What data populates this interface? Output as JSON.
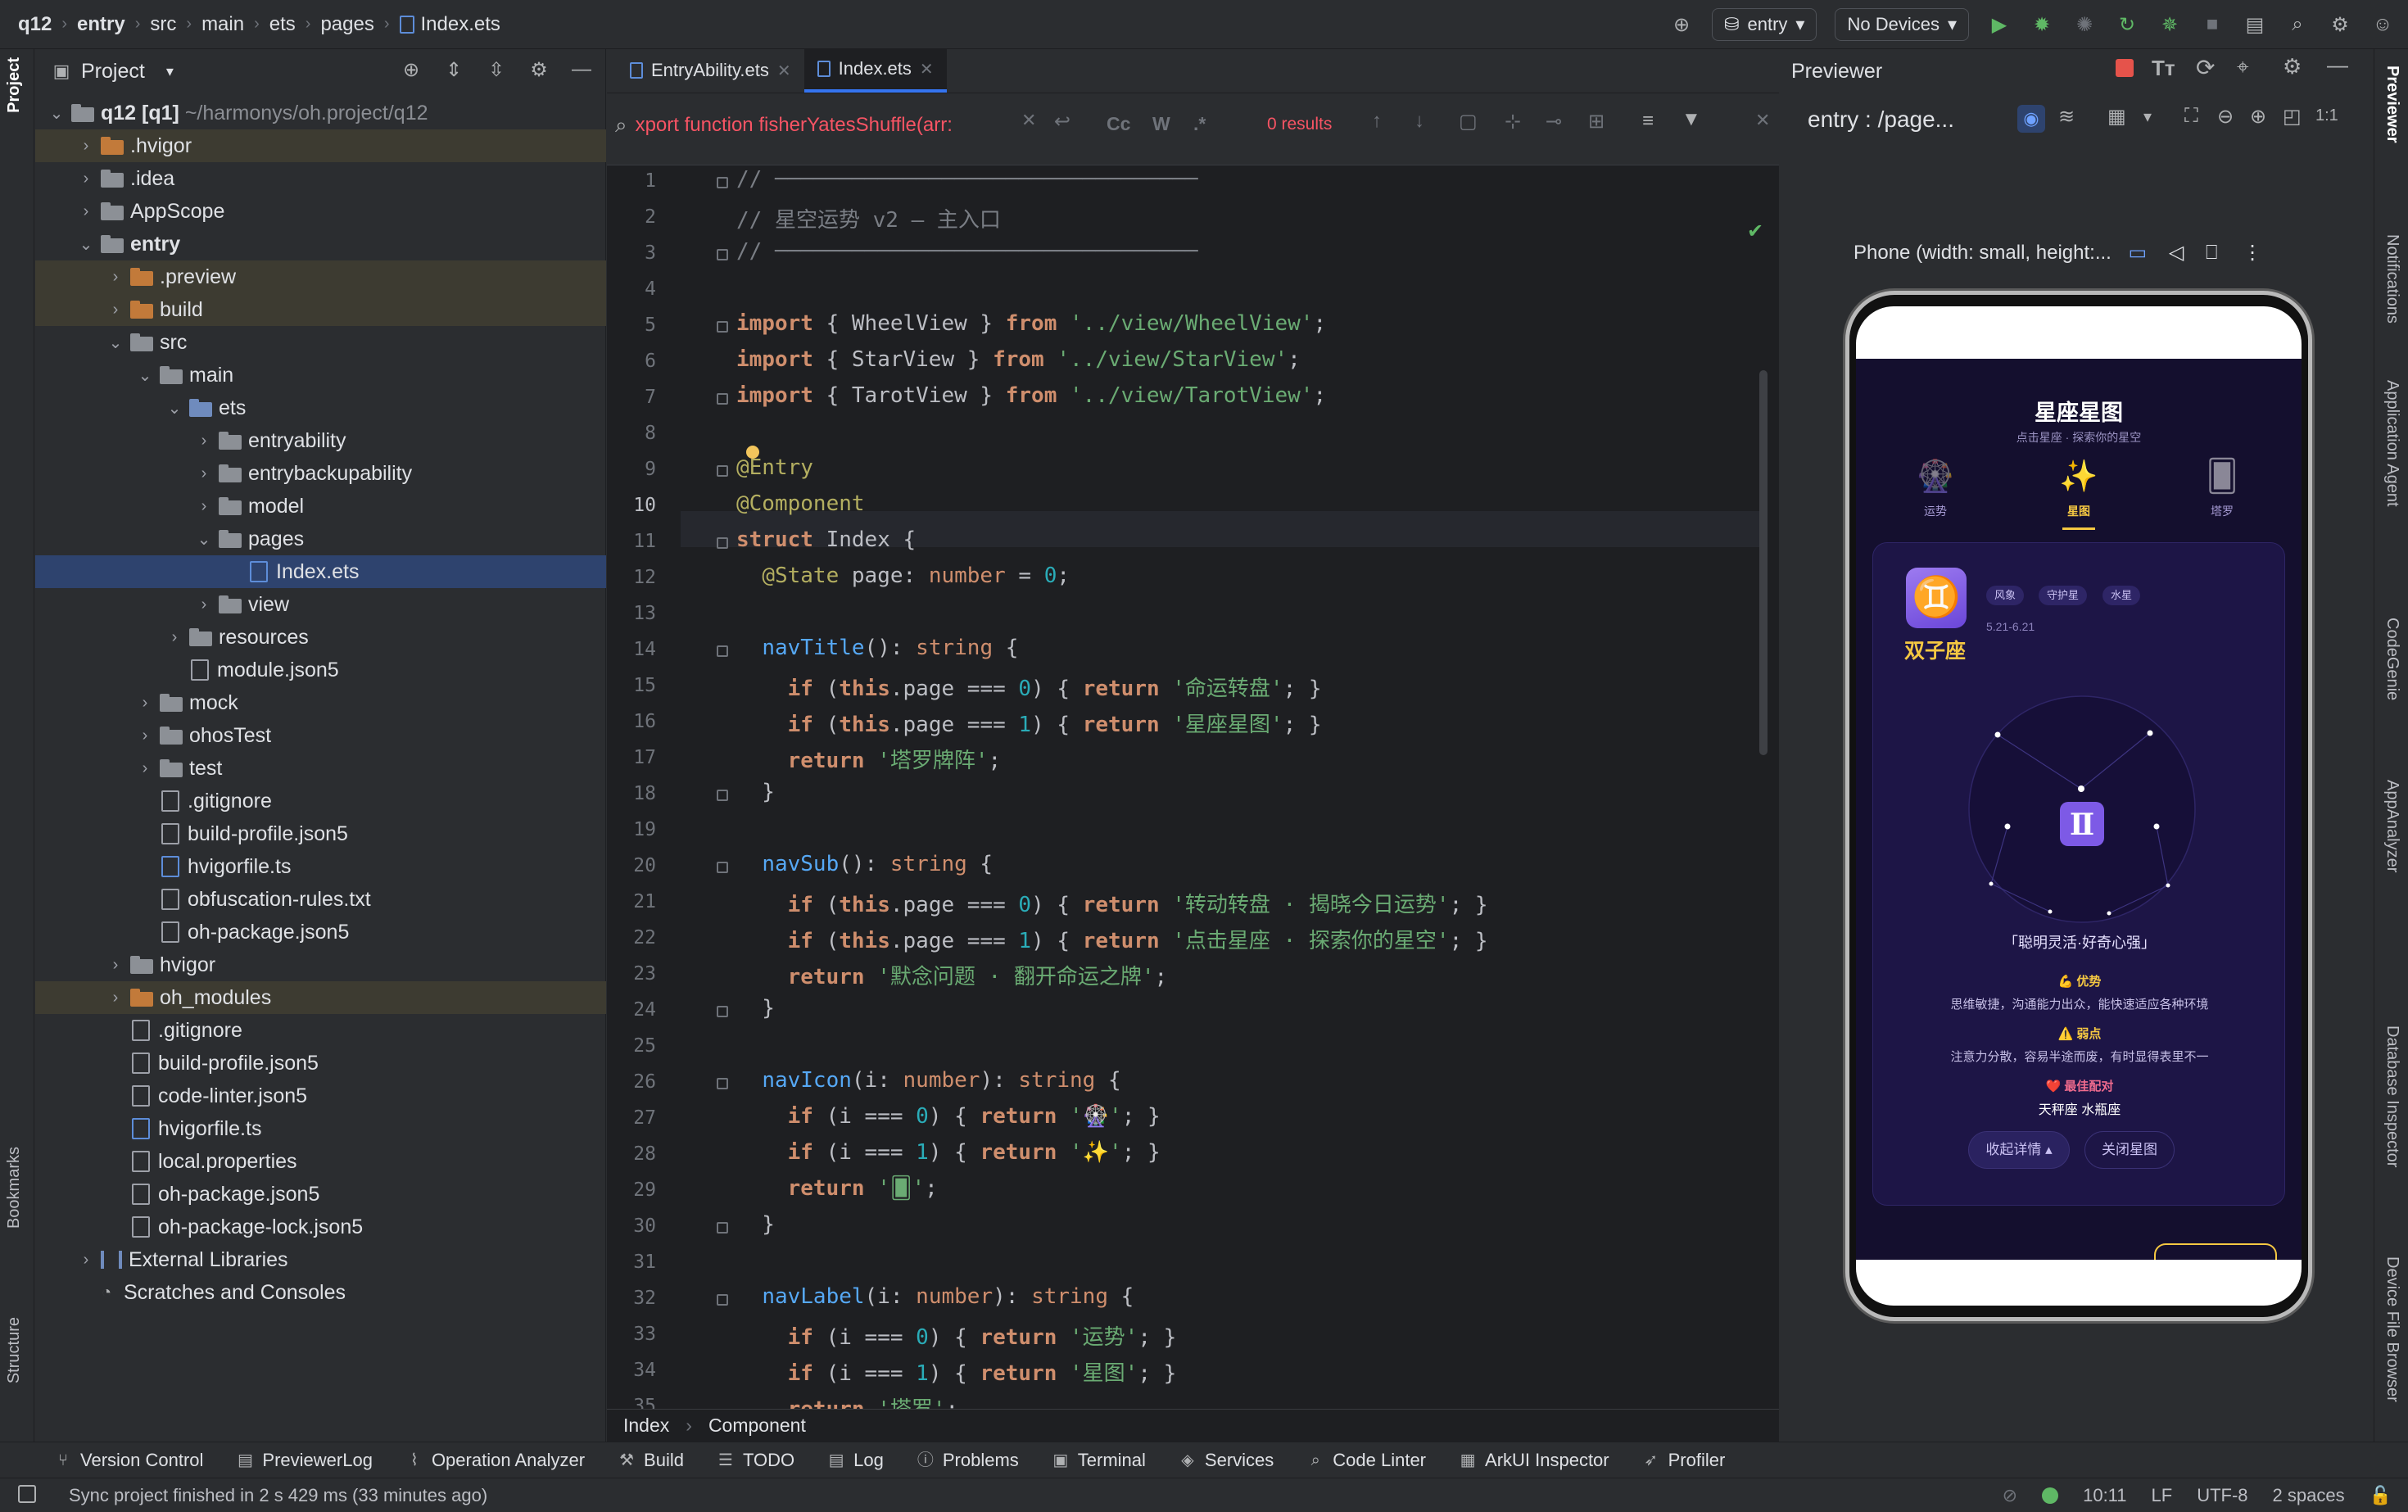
{
  "titlebar": {
    "crumbs": [
      "q12",
      "entry",
      "src",
      "main",
      "ets",
      "pages",
      "Index.ets"
    ],
    "run_config": "entry",
    "device": "No Devices"
  },
  "left_strip": {
    "project": "Project",
    "bookmarks": "Bookmarks",
    "structure": "Structure"
  },
  "right_strip": {
    "previewer": "Previewer",
    "notifications": "Notifications",
    "app_agent": "Application Agent",
    "codegenie": "CodeGenie",
    "appanalyzer": "AppAnalyzer",
    "db_inspector": "Database Inspector",
    "device_file": "Device File Browser"
  },
  "project": {
    "title": "Project",
    "root": "q12 [q1]",
    "root_path": "~/harmonys/oh.project/q12",
    "items": [
      ".hvigor",
      ".idea",
      "AppScope",
      "entry",
      ".preview",
      "build",
      "src",
      "main",
      "ets",
      "entryability",
      "entrybackupability",
      "model",
      "pages",
      "Index.ets",
      "view",
      "resources",
      "module.json5",
      "mock",
      "ohosTest",
      "test",
      ".gitignore",
      "build-profile.json5",
      "hvigorfile.ts",
      "obfuscation-rules.txt",
      "oh-package.json5",
      "hvigor",
      "oh_modules",
      ".gitignore",
      "build-profile.json5",
      "code-linter.json5",
      "hvigorfile.ts",
      "local.properties",
      "oh-package.json5",
      "oh-package-lock.json5",
      "External Libraries",
      "Scratches and Consoles"
    ]
  },
  "editor": {
    "tabs": [
      "EntryAbility.ets",
      "Index.ets"
    ],
    "find_query": "xport function fisherYatesShuffle(arr:",
    "find_results": "0 results",
    "find_opts": [
      "Cc",
      "W",
      ".*"
    ],
    "breadcrumb": [
      "Index",
      "Component"
    ],
    "line_numbers": [
      "1",
      "2",
      "3",
      "4",
      "5",
      "6",
      "7",
      "8",
      "9",
      "10",
      "11",
      "12",
      "13",
      "14",
      "15",
      "16",
      "17",
      "18",
      "19",
      "20",
      "21",
      "22",
      "23",
      "24",
      "25",
      "26",
      "27",
      "28",
      "29",
      "30",
      "31",
      "32",
      "33",
      "34",
      "35"
    ],
    "code_lines": [
      "// ─────────────────────────────────",
      "// 星空运势 v2 — 主入口",
      "// ─────────────────────────────────",
      "",
      "import { WheelView } from '../view/WheelView';",
      "import { StarView } from '../view/StarView';",
      "import { TarotView } from '../view/TarotView';",
      "",
      "@Entry",
      "@Component",
      "struct Index {",
      "  @State page: number = 0;",
      "",
      "  navTitle(): string {",
      "    if (this.page === 0) { return '命运转盘'; }",
      "    if (this.page === 1) { return '星座星图'; }",
      "    return '塔罗牌阵';",
      "  }",
      "",
      "  navSub(): string {",
      "    if (this.page === 0) { return '转动转盘 · 揭晓今日运势'; }",
      "    if (this.page === 1) { return '点击星座 · 探索你的星空'; }",
      "    return '默念问题 · 翻开命运之牌';",
      "  }",
      "",
      "  navIcon(i: number): string {",
      "    if (i === 0) { return '🎡'; }",
      "    if (i === 1) { return '✨'; }",
      "    return '🂠';",
      "  }",
      "",
      "  navLabel(i: number): string {",
      "    if (i === 0) { return '运势'; }",
      "    if (i === 1) { return '星图'; }",
      "    return '塔罗';"
    ]
  },
  "previewer": {
    "title": "Previewer",
    "page": "entry : /page...",
    "device_label": "Phone (width: small, height:...",
    "app": {
      "title": "星座星图",
      "subtitle": "点击星座 · 探索你的星空",
      "nav": [
        {
          "icon": "🎡",
          "label": "运势"
        },
        {
          "icon": "✨",
          "label": "星图"
        },
        {
          "icon": "🂠",
          "label": "塔罗"
        }
      ],
      "sign_glyph": "♊",
      "sign_name": "双子座",
      "chips": [
        "风象",
        "守护星",
        "水星"
      ],
      "date_range": "5.21-6.21",
      "quote": "「聪明灵活·好奇心强」",
      "strength_label": "💪 优势",
      "strength_text": "思维敏捷，沟通能力出众，能快速适应各种环境",
      "weakness_label": "⚠️ 弱点",
      "weakness_text": "注意力分散，容易半途而废，有时显得表里不一",
      "match_label": "❤️ 最佳配对",
      "match_text": "天秤座 水瓶座",
      "btn_collapse": "收起详情 ▴",
      "btn_close": "关闭星图"
    }
  },
  "bottombar": [
    "Version Control",
    "PreviewerLog",
    "Operation Analyzer",
    "Build",
    "TODO",
    "Log",
    "Problems",
    "Terminal",
    "Services",
    "Code Linter",
    "ArkUI Inspector",
    "Profiler"
  ],
  "statusbar": {
    "message": "Sync project finished in 2 s 429 ms (33 minutes ago)",
    "position": "10:11",
    "line_sep": "LF",
    "encoding": "UTF-8",
    "indent": "2 spaces"
  },
  "colors": {
    "accent": "#3574f0",
    "keyword": "#cf8e6d",
    "string": "#6aab73",
    "function": "#56a8f5",
    "annotation": "#b3ae60",
    "error": "#f75464"
  }
}
